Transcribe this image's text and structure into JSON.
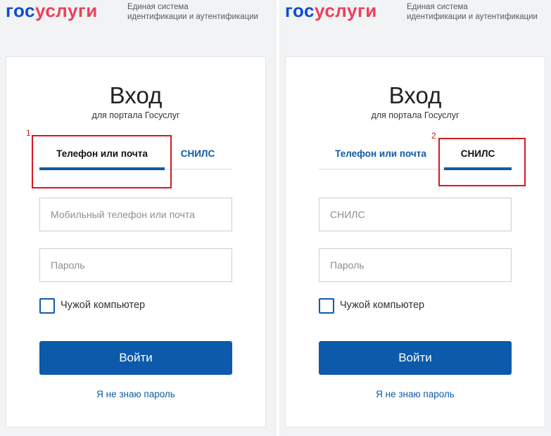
{
  "brand": {
    "logo_part1": "гос",
    "logo_part2": "услуги",
    "tagline_line1": "Единая система",
    "tagline_line2": "идентификации и аутентификации"
  },
  "colors": {
    "brand_blue": "#0d4cd3",
    "brand_red": "#ee3f58",
    "button_blue": "#0d5aaa",
    "link_blue": "#0f5ba7",
    "highlight_red": "#d7191f"
  },
  "left": {
    "title": "Вход",
    "subtitle": "для портала Госуслуг",
    "tabs": [
      {
        "label": "Телефон или почта",
        "active": true
      },
      {
        "label": "СНИЛС",
        "active": false
      }
    ],
    "login_placeholder": "Мобильный телефон или почта",
    "password_placeholder": "Пароль",
    "checkbox_label": "Чужой компьютер",
    "checkbox_checked": false,
    "login_button": "Войти",
    "forgot_link": "Я не знаю пароль",
    "annotation_number": "1"
  },
  "right": {
    "title": "Вход",
    "subtitle": "для портала Госуслуг",
    "tabs": [
      {
        "label": "Телефон или почта",
        "active": false
      },
      {
        "label": "СНИЛС",
        "active": true
      }
    ],
    "login_placeholder": "СНИЛС",
    "password_placeholder": "Пароль",
    "checkbox_label": "Чужой компьютер",
    "checkbox_checked": false,
    "login_button": "Войти",
    "forgot_link": "Я не знаю пароль",
    "annotation_number": "2"
  }
}
